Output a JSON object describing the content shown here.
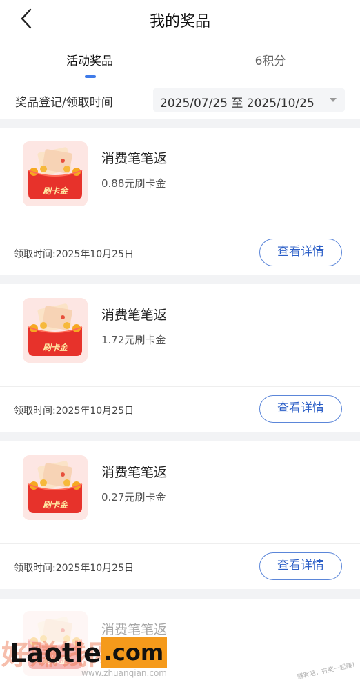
{
  "header": {
    "title": "我的奖品",
    "back_icon": "chevron-left-icon"
  },
  "tabs": [
    {
      "label": "活动奖品",
      "active": true
    },
    {
      "label": "6积分",
      "active": false
    }
  ],
  "filter": {
    "label": "奖品登记/领取时间",
    "date_range": "2025/07/25  至  2025/10/25",
    "dropdown_icon": "caret-down-icon"
  },
  "prizes": [
    {
      "name": "消费笔笔返",
      "value": "0.88元刷卡金",
      "claim_time": "领取时间:2025年10月25日",
      "button": "查看详情",
      "image_text": "刷卡金"
    },
    {
      "name": "消费笔笔返",
      "value": "1.72元刷卡金",
      "claim_time": "领取时间:2025年10月25日",
      "button": "查看详情",
      "image_text": "刷卡金"
    },
    {
      "name": "消费笔笔返",
      "value": "0.27元刷卡金",
      "claim_time": "领取时间:2025年10月25日",
      "button": "查看详情",
      "image_text": "刷卡金"
    },
    {
      "name": "消费笔笔返",
      "image_text": "刷卡金"
    }
  ],
  "watermark": {
    "logo_text": "Laotie8",
    "logo_suffix": ".com",
    "han_text": "好赚钱网",
    "site_small": "www.zhuanqian.com",
    "corner_text": "赚客吧，有奖一起赚！"
  },
  "colors": {
    "accent": "#3f7be9",
    "button_border": "#5b86d9",
    "button_text": "#2c5fc7",
    "page_bg": "#f2f3f5",
    "watermark_orange": "#f59a1b"
  }
}
